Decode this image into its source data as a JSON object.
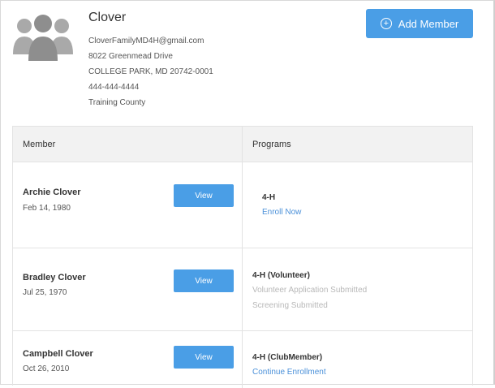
{
  "family": {
    "name": "Clover",
    "email": "CloverFamilyMD4H@gmail.com",
    "address_line1": "8022 Greenmead Drive",
    "address_line2": "COLLEGE PARK, MD 20742-0001",
    "phone": "444-444-4444",
    "county": "Training County",
    "avatar_icon": "family-group-icon"
  },
  "actions": {
    "add_member_label": "Add Member",
    "add_icon": "plus-circle-icon"
  },
  "table": {
    "headers": {
      "member": "Member",
      "programs": "Programs"
    },
    "rows": [
      {
        "name": "Archie Clover",
        "dob": "Feb 14, 1980",
        "view_label": "View",
        "program": "4-H",
        "link": "Enroll Now"
      },
      {
        "name": "Bradley Clover",
        "dob": "Jul 25, 1970",
        "view_label": "View",
        "program": "4-H (Volunteer)",
        "status1": "Volunteer Application Submitted",
        "status2": "Screening Submitted"
      },
      {
        "name": "Campbell Clover",
        "dob": "Oct 26, 2010",
        "view_label": "View",
        "program": "4-H (ClubMember)",
        "link": "Continue Enrollment"
      }
    ]
  },
  "colors": {
    "accent": "#4a9ee6",
    "link": "#4a90d9",
    "muted": "#b8b8b8",
    "header_bg": "#f2f2f2"
  }
}
